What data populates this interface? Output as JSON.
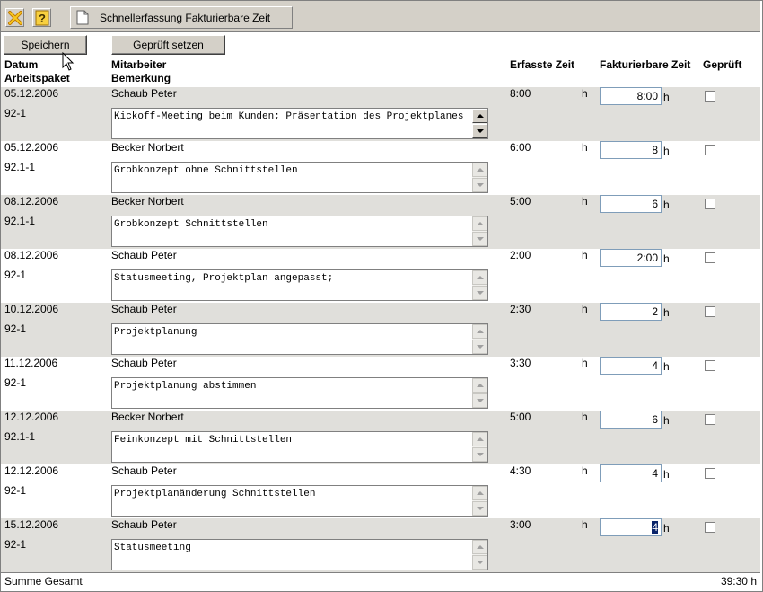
{
  "toolbar": {
    "close_icon": "close-x-icon",
    "help_icon": "help-question-icon",
    "tab_icon": "document-icon",
    "tab_label": "Schnellerfassung Fakturierbare Zeit"
  },
  "actions": {
    "save_label": "Speichern",
    "set_checked_label": "Geprüft setzen"
  },
  "header": {
    "datum": "Datum",
    "arbeitspaket": "Arbeitspaket",
    "mitarbeiter": "Mitarbeiter",
    "bemerkung": "Bemerkung",
    "erfasste_zeit": "Erfasste Zeit",
    "fakturierbare_zeit": "Fakturierbare Zeit",
    "geprueft": "Geprüft"
  },
  "unit": "h",
  "rows": [
    {
      "date": "05.12.2006",
      "ap": "92-1",
      "employee": "Schaub Peter",
      "note": "Kickoff-Meeting beim Kunden; Präsentation des Projektplanes",
      "recorded": "8:00",
      "billable": "8:00",
      "checked": false,
      "scroll_active": true
    },
    {
      "date": "05.12.2006",
      "ap": "92.1-1",
      "employee": "Becker Norbert",
      "note": "Grobkonzept ohne Schnittstellen",
      "recorded": "6:00",
      "billable": "8",
      "checked": false,
      "scroll_active": false
    },
    {
      "date": "08.12.2006",
      "ap": "92.1-1",
      "employee": "Becker Norbert",
      "note": "Grobkonzept Schnittstellen",
      "recorded": "5:00",
      "billable": "6",
      "checked": false,
      "scroll_active": false
    },
    {
      "date": "08.12.2006",
      "ap": "92-1",
      "employee": "Schaub Peter",
      "note": "Statusmeeting, Projektplan angepasst;",
      "recorded": "2:00",
      "billable": "2:00",
      "checked": false,
      "scroll_active": false
    },
    {
      "date": "10.12.2006",
      "ap": "92-1",
      "employee": "Schaub Peter",
      "note": "Projektplanung",
      "recorded": "2:30",
      "billable": "2",
      "checked": false,
      "scroll_active": false
    },
    {
      "date": "11.12.2006",
      "ap": "92-1",
      "employee": "Schaub Peter",
      "note": "Projektplanung abstimmen",
      "recorded": "3:30",
      "billable": "4",
      "checked": false,
      "scroll_active": false
    },
    {
      "date": "12.12.2006",
      "ap": "92.1-1",
      "employee": "Becker Norbert",
      "note": "Feinkonzept mit Schnittstellen",
      "recorded": "5:00",
      "billable": "6",
      "checked": false,
      "scroll_active": false
    },
    {
      "date": "12.12.2006",
      "ap": "92-1",
      "employee": "Schaub Peter",
      "note": "Projektplanänderung Schnittstellen",
      "recorded": "4:30",
      "billable": "4",
      "checked": false,
      "scroll_active": false
    },
    {
      "date": "15.12.2006",
      "ap": "92-1",
      "employee": "Schaub Peter",
      "note": "Statusmeeting",
      "recorded": "3:00",
      "billable": "4",
      "checked": false,
      "scroll_active": false,
      "billable_selected": true
    }
  ],
  "footer": {
    "label": "Summe Gesamt",
    "total": "39:30 h"
  },
  "colors": {
    "toolbar_bg": "#d4d0c8",
    "row_shaded": "#e0dfdb",
    "input_border": "#7f9db9",
    "selection": "#0a246a",
    "close_icon": "#e8b000"
  }
}
